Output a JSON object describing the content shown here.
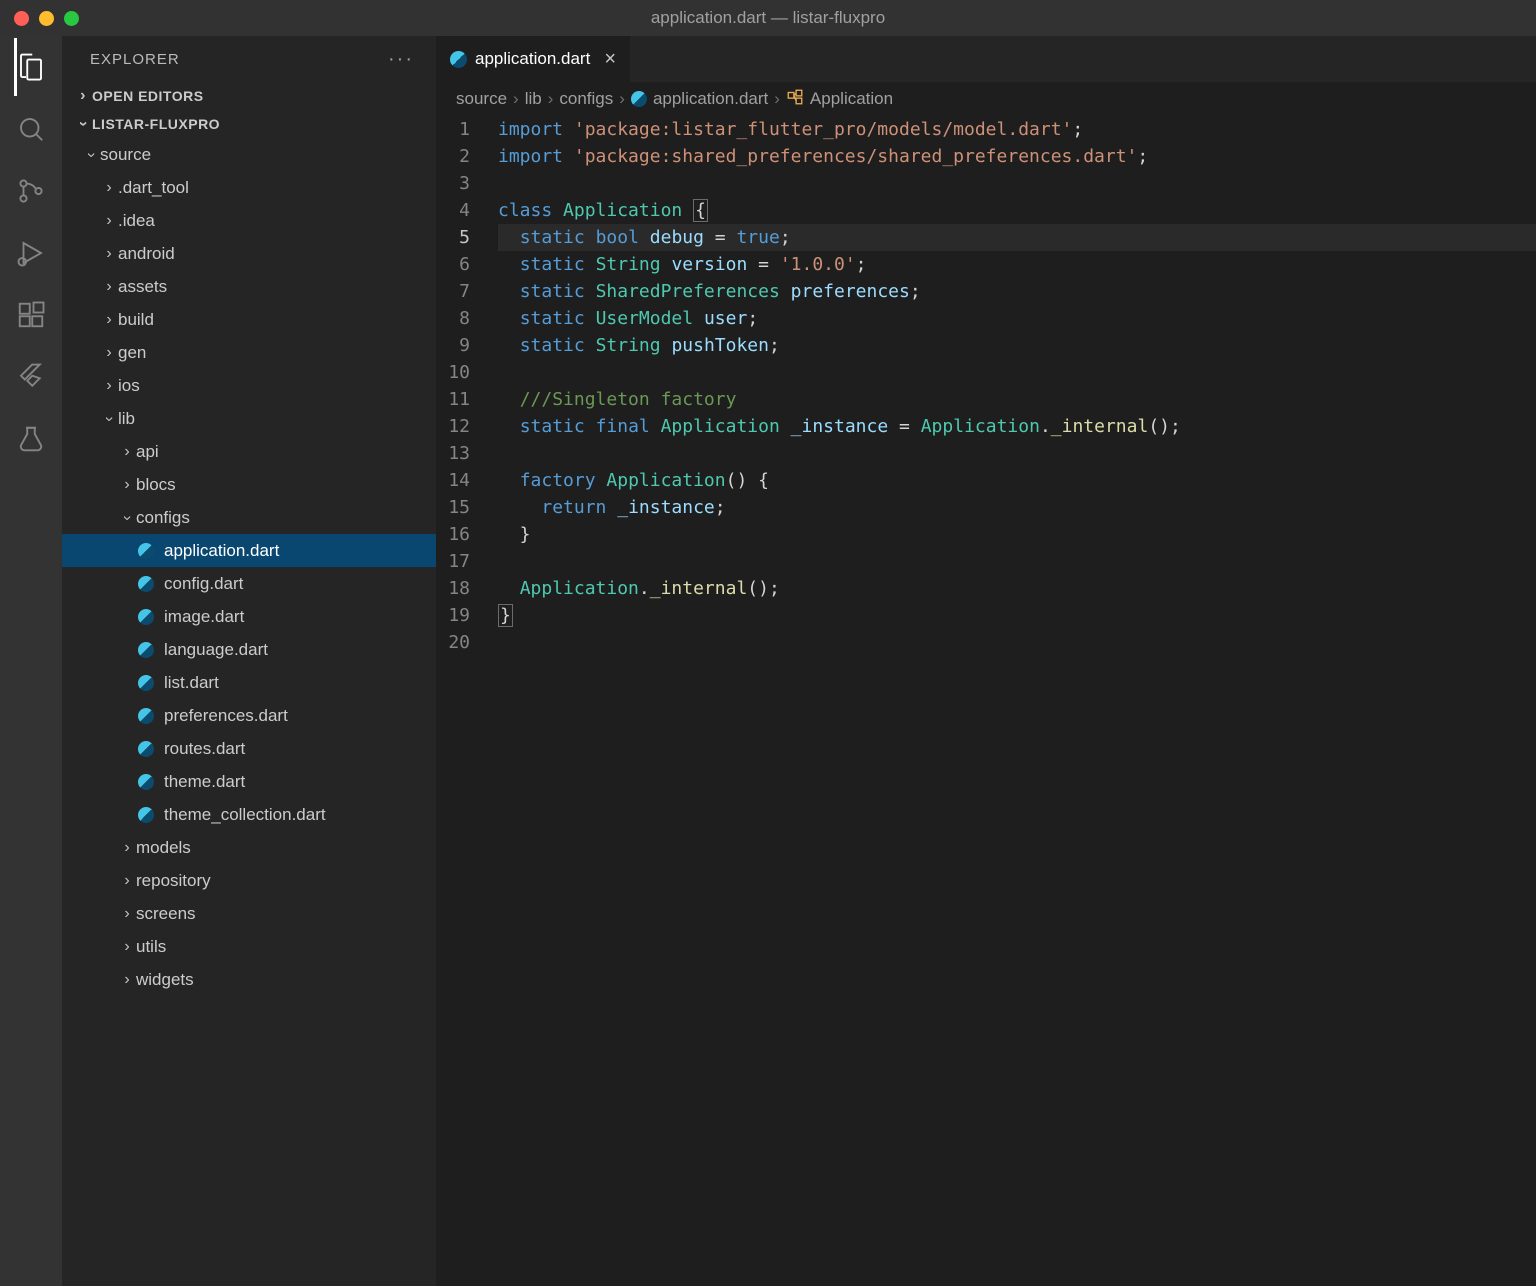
{
  "window": {
    "title": "application.dart — listar-fluxpro"
  },
  "sidebar": {
    "title": "EXPLORER",
    "sections": {
      "open_editors": "OPEN EDITORS",
      "project": "LISTAR-FLUXPRO"
    },
    "tree": [
      {
        "label": "source",
        "depth": 0,
        "type": "folder",
        "expanded": true
      },
      {
        "label": ".dart_tool",
        "depth": 1,
        "type": "folder",
        "expanded": false
      },
      {
        "label": ".idea",
        "depth": 1,
        "type": "folder",
        "expanded": false
      },
      {
        "label": "android",
        "depth": 1,
        "type": "folder",
        "expanded": false
      },
      {
        "label": "assets",
        "depth": 1,
        "type": "folder",
        "expanded": false
      },
      {
        "label": "build",
        "depth": 1,
        "type": "folder",
        "expanded": false
      },
      {
        "label": "gen",
        "depth": 1,
        "type": "folder",
        "expanded": false
      },
      {
        "label": "ios",
        "depth": 1,
        "type": "folder",
        "expanded": false
      },
      {
        "label": "lib",
        "depth": 1,
        "type": "folder",
        "expanded": true
      },
      {
        "label": "api",
        "depth": 2,
        "type": "folder",
        "expanded": false
      },
      {
        "label": "blocs",
        "depth": 2,
        "type": "folder",
        "expanded": false
      },
      {
        "label": "configs",
        "depth": 2,
        "type": "folder",
        "expanded": true
      },
      {
        "label": "application.dart",
        "depth": 3,
        "type": "dart",
        "selected": true
      },
      {
        "label": "config.dart",
        "depth": 3,
        "type": "dart"
      },
      {
        "label": "image.dart",
        "depth": 3,
        "type": "dart"
      },
      {
        "label": "language.dart",
        "depth": 3,
        "type": "dart"
      },
      {
        "label": "list.dart",
        "depth": 3,
        "type": "dart"
      },
      {
        "label": "preferences.dart",
        "depth": 3,
        "type": "dart"
      },
      {
        "label": "routes.dart",
        "depth": 3,
        "type": "dart"
      },
      {
        "label": "theme.dart",
        "depth": 3,
        "type": "dart"
      },
      {
        "label": "theme_collection.dart",
        "depth": 3,
        "type": "dart"
      },
      {
        "label": "models",
        "depth": 2,
        "type": "folder",
        "expanded": false
      },
      {
        "label": "repository",
        "depth": 2,
        "type": "folder",
        "expanded": false
      },
      {
        "label": "screens",
        "depth": 2,
        "type": "folder",
        "expanded": false
      },
      {
        "label": "utils",
        "depth": 2,
        "type": "folder",
        "expanded": false
      },
      {
        "label": "widgets",
        "depth": 2,
        "type": "folder",
        "expanded": false
      }
    ]
  },
  "editor": {
    "tab": {
      "label": "application.dart"
    },
    "breadcrumbs": [
      "source",
      "lib",
      "configs",
      "application.dart",
      "Application"
    ],
    "current_line": 5,
    "lines": [
      [
        [
          "keyword",
          "import"
        ],
        [
          "punct",
          " "
        ],
        [
          "string",
          "'package:listar_flutter_pro/models/model.dart'"
        ],
        [
          "punct",
          ";"
        ]
      ],
      [
        [
          "keyword",
          "import"
        ],
        [
          "punct",
          " "
        ],
        [
          "string",
          "'package:shared_preferences/shared_preferences.dart'"
        ],
        [
          "punct",
          ";"
        ]
      ],
      [],
      [
        [
          "keyword",
          "class"
        ],
        [
          "punct",
          " "
        ],
        [
          "type",
          "Application"
        ],
        [
          "punct",
          " "
        ],
        [
          "bracket",
          "{"
        ]
      ],
      [
        [
          "punct",
          "  "
        ],
        [
          "keyword",
          "static"
        ],
        [
          "punct",
          " "
        ],
        [
          "keyword",
          "bool"
        ],
        [
          "punct",
          " "
        ],
        [
          "var",
          "debug"
        ],
        [
          "punct",
          " = "
        ],
        [
          "literal",
          "true"
        ],
        [
          "punct",
          ";"
        ]
      ],
      [
        [
          "punct",
          "  "
        ],
        [
          "keyword",
          "static"
        ],
        [
          "punct",
          " "
        ],
        [
          "type",
          "String"
        ],
        [
          "punct",
          " "
        ],
        [
          "var",
          "version"
        ],
        [
          "punct",
          " = "
        ],
        [
          "string",
          "'1.0.0'"
        ],
        [
          "punct",
          ";"
        ]
      ],
      [
        [
          "punct",
          "  "
        ],
        [
          "keyword",
          "static"
        ],
        [
          "punct",
          " "
        ],
        [
          "type",
          "SharedPreferences"
        ],
        [
          "punct",
          " "
        ],
        [
          "var",
          "preferences"
        ],
        [
          "punct",
          ";"
        ]
      ],
      [
        [
          "punct",
          "  "
        ],
        [
          "keyword",
          "static"
        ],
        [
          "punct",
          " "
        ],
        [
          "type",
          "UserModel"
        ],
        [
          "punct",
          " "
        ],
        [
          "var",
          "user"
        ],
        [
          "punct",
          ";"
        ]
      ],
      [
        [
          "punct",
          "  "
        ],
        [
          "keyword",
          "static"
        ],
        [
          "punct",
          " "
        ],
        [
          "type",
          "String"
        ],
        [
          "punct",
          " "
        ],
        [
          "var",
          "pushToken"
        ],
        [
          "punct",
          ";"
        ]
      ],
      [],
      [
        [
          "punct",
          "  "
        ],
        [
          "comment",
          "///Singleton factory"
        ]
      ],
      [
        [
          "punct",
          "  "
        ],
        [
          "keyword",
          "static"
        ],
        [
          "punct",
          " "
        ],
        [
          "keyword",
          "final"
        ],
        [
          "punct",
          " "
        ],
        [
          "type",
          "Application"
        ],
        [
          "punct",
          " "
        ],
        [
          "var",
          "_instance"
        ],
        [
          "punct",
          " = "
        ],
        [
          "type",
          "Application"
        ],
        [
          "punct",
          "."
        ],
        [
          "method",
          "_internal"
        ],
        [
          "punct",
          "();"
        ]
      ],
      [],
      [
        [
          "punct",
          "  "
        ],
        [
          "keyword",
          "factory"
        ],
        [
          "punct",
          " "
        ],
        [
          "type",
          "Application"
        ],
        [
          "punct",
          "() {"
        ]
      ],
      [
        [
          "punct",
          "    "
        ],
        [
          "keyword",
          "return"
        ],
        [
          "punct",
          " "
        ],
        [
          "var",
          "_instance"
        ],
        [
          "punct",
          ";"
        ]
      ],
      [
        [
          "punct",
          "  }"
        ]
      ],
      [],
      [
        [
          "punct",
          "  "
        ],
        [
          "type",
          "Application"
        ],
        [
          "punct",
          "."
        ],
        [
          "method",
          "_internal"
        ],
        [
          "punct",
          "();"
        ]
      ],
      [
        [
          "bracket",
          "}"
        ]
      ],
      []
    ]
  }
}
